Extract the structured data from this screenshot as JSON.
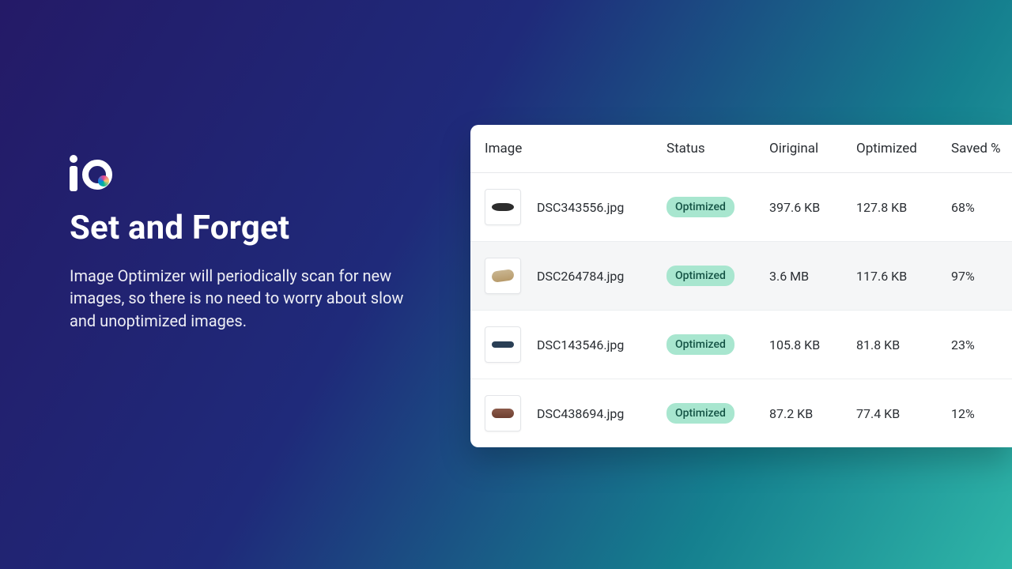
{
  "hero": {
    "title": "Set and Forget",
    "description": "Image Optimizer will periodically scan for new images, so there is no need to worry about slow and unoptimized images."
  },
  "table": {
    "headers": {
      "image": "Image",
      "status": "Status",
      "original": "Oiriginal",
      "optimized": "Optimized",
      "saved": "Saved %"
    },
    "status_label": "Optimized",
    "rows": [
      {
        "file": "DSC343556.jpg",
        "original": "397.6 KB",
        "optimized": "127.8 KB",
        "saved": "68%"
      },
      {
        "file": "DSC264784.jpg",
        "original": "3.6 MB",
        "optimized": "117.6 KB",
        "saved": "97%"
      },
      {
        "file": "DSC143546.jpg",
        "original": "105.8 KB",
        "optimized": "81.8 KB",
        "saved": "23%"
      },
      {
        "file": "DSC438694.jpg",
        "original": "87.2 KB",
        "optimized": "77.4 KB",
        "saved": "12%"
      }
    ]
  }
}
